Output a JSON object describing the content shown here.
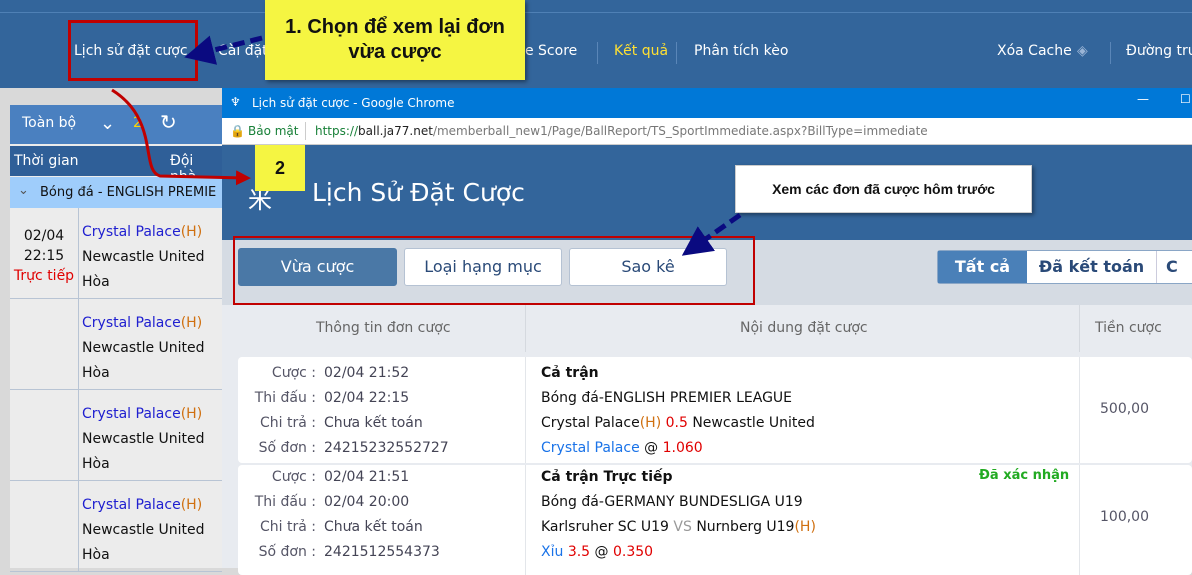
{
  "topnav": {
    "items": [
      {
        "label": "Lịch sử đặt cược"
      },
      {
        "label": "Cài đặt"
      },
      {
        "label": "Live Score"
      },
      {
        "label": "Kết quả",
        "active": true
      },
      {
        "label": "Phân tích kèo"
      }
    ],
    "clear_cache": "Xóa Cache",
    "right_link": "Đường tru"
  },
  "left": {
    "toolbar": {
      "all": "Toàn bộ",
      "count": "2"
    },
    "headers": {
      "time": "Thời gian",
      "home": "Đội nhà"
    },
    "group": "Bóng đá - ENGLISH PREMIE",
    "rows": [
      {
        "date": "02/04",
        "time": "22:15",
        "status": "Trực tiếp",
        "home": "Crystal Palace",
        "h": "(H)",
        "away": "Newcastle United",
        "draw": "Hòa"
      },
      {
        "home": "Crystal Palace",
        "h": "(H)",
        "away": "Newcastle United",
        "draw": "Hòa"
      },
      {
        "home": "Crystal Palace",
        "h": "(H)",
        "away": "Newcastle United",
        "draw": "Hòa"
      },
      {
        "home": "Crystal Palace",
        "h": "(H)",
        "away": "Newcastle United",
        "draw": "Hòa"
      }
    ]
  },
  "chrome": {
    "title": "Lịch sử đặt cược - Google Chrome",
    "secure": "Bảo mật",
    "url_scheme": "https://",
    "url_host": "ball.ja77.net",
    "url_path": "/memberball_new1/Page/BallReport/TS_SportImmediate.aspx?BillType=immediate"
  },
  "page": {
    "title": "Lịch Sử Đặt Cược",
    "tabs": [
      "Vừa cược",
      "Loại hạng mục",
      "Sao kê"
    ],
    "filters": [
      "Tất cả",
      "Đã kết toán",
      "C"
    ],
    "columns": [
      "Thông tin đơn cược",
      "Nội dung đặt cược",
      "Tiền cược"
    ],
    "labels": {
      "bet": "Cược :",
      "match": "Thi đấu :",
      "pay": "Chi trả :",
      "ticket": "Số đơn :"
    },
    "bets": [
      {
        "bet_time": "02/04 21:52",
        "match_time": "02/04 22:15",
        "pay": "Chưa kết toán",
        "ticket": "24215232552727",
        "type": "Cả trận",
        "league": "Bóng đá-ENGLISH PREMIER LEAGUE",
        "home": "Crystal Palace",
        "h": "(H)",
        "hdp": "0.5",
        "away": "Newcastle United",
        "pick": "Crystal Palace",
        "at": "@",
        "odds": "1.060",
        "status": "",
        "stake": "500,00"
      },
      {
        "bet_time": "02/04 21:51",
        "match_time": "02/04 20:00",
        "pay": "Chưa kết toán",
        "ticket": "2421512554373",
        "type": "Cả trận Trực tiếp",
        "league": "Bóng đá-GERMANY BUNDESLIGA U19",
        "home": "Karlsruher SC U19",
        "vs": "VS",
        "away": "Nurnberg U19",
        "h": "(H)",
        "pick": "Xỉu",
        "line": "3.5",
        "at": "@",
        "odds": "0.350",
        "status": "Đã xác nhận",
        "stake": "100,00"
      }
    ]
  },
  "annotations": {
    "step1": "1. Chọn để xem lại đơn vừa cược",
    "step2": "2",
    "callout": "Xem các đơn đã cược hôm trước"
  }
}
